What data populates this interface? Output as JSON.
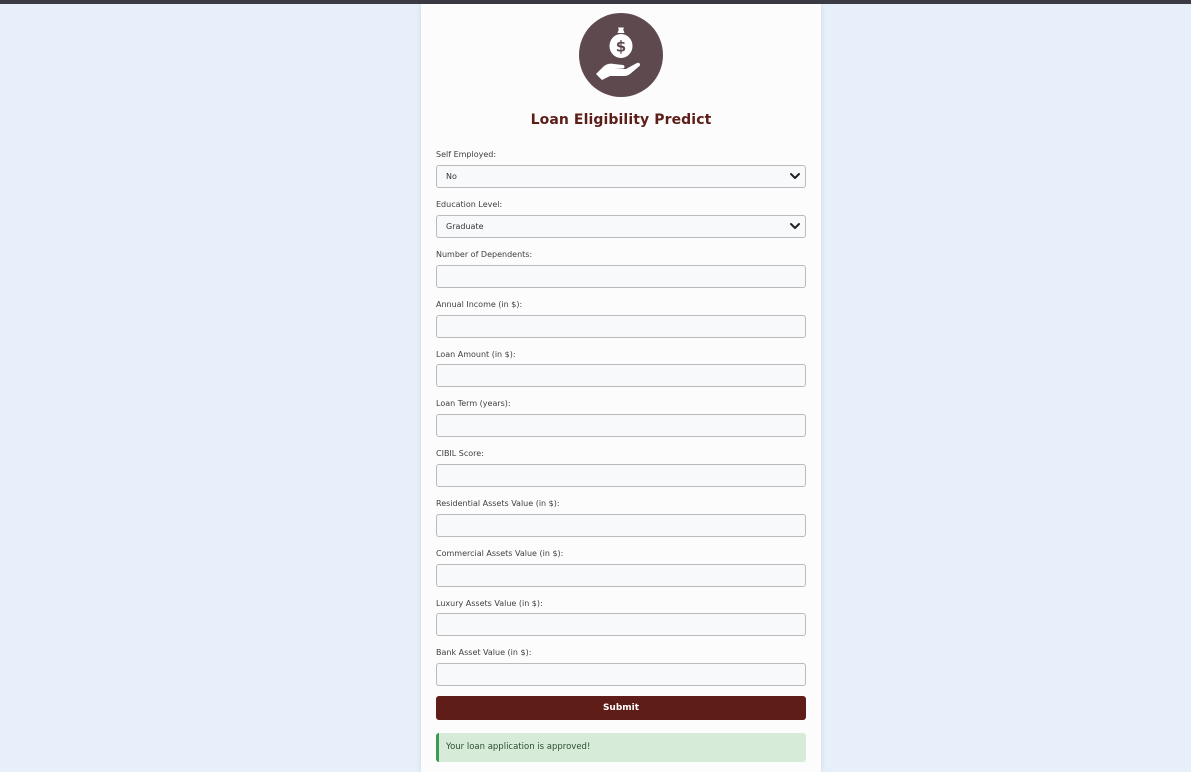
{
  "page": {
    "title": "Loan Eligibility Predict",
    "logo_icon": "money-bag-hand-icon",
    "colors": {
      "background": "#e7f0fa",
      "title": "#5c1e17",
      "submit": "#5f1d18",
      "success_bg": "#d6ebd8",
      "success_border": "#3c9a53",
      "logo_bg": "#5e4a4e"
    }
  },
  "form": {
    "self_employed": {
      "label": "Self Employed:",
      "value": "No"
    },
    "education": {
      "label": "Education Level:",
      "value": "Graduate"
    },
    "dependents": {
      "label": "Number of Dependents:",
      "value": ""
    },
    "annual_income": {
      "label": "Annual Income (in $):",
      "value": ""
    },
    "loan_amount": {
      "label": "Loan Amount (in $):",
      "value": ""
    },
    "loan_term": {
      "label": "Loan Term (years):",
      "value": ""
    },
    "cibil_score": {
      "label": "CIBIL Score:",
      "value": ""
    },
    "residential_assets": {
      "label": "Residential Assets Value (in $):",
      "value": ""
    },
    "commercial_assets": {
      "label": "Commercial Assets Value (in $):",
      "value": ""
    },
    "luxury_assets": {
      "label": "Luxury Assets Value (in $):",
      "value": ""
    },
    "bank_asset": {
      "label": "Bank Asset Value (in $):",
      "value": ""
    },
    "submit_label": "Submit"
  },
  "result": {
    "message": "Your loan application is approved!"
  }
}
